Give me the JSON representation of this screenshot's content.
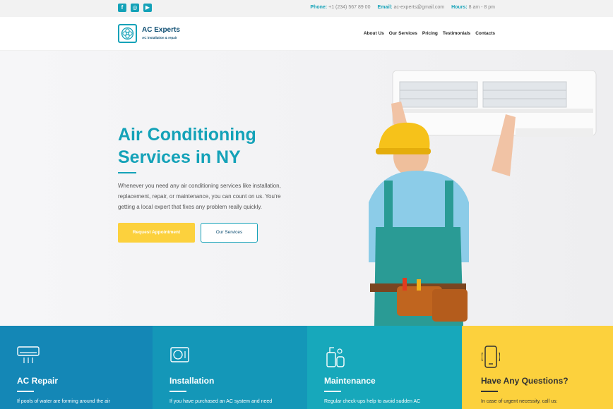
{
  "topbar": {
    "social": [
      {
        "icon": "facebook-icon",
        "glyph": "f"
      },
      {
        "icon": "instagram-icon",
        "glyph": "◎"
      },
      {
        "icon": "youtube-icon",
        "glyph": "▶"
      }
    ],
    "phone_label": "Phone:",
    "phone_value": "+1 (234) 567 89 00",
    "email_label": "Email:",
    "email_value": "ac-experts@gmail.com",
    "hours_label": "Hours:",
    "hours_value": "8 am - 8 pm"
  },
  "header": {
    "brand_name": "AC Experts",
    "brand_tagline": "AC installation & repair",
    "nav": [
      "About Us",
      "Our Services",
      "Pricing",
      "Testimonials",
      "Contacts"
    ]
  },
  "hero": {
    "title": "Air Conditioning Services in NY",
    "text": "Whenever you need any air conditioning services like installation, replacement, repair, or maintenance, you can count on us. You're getting a local expert that fixes any problem really quickly.",
    "primary_button": "Request Appointment",
    "secondary_button": "Our Services"
  },
  "services": [
    {
      "title": "AC Repair",
      "text": "If pools of water are forming around the air",
      "icon": "ac-unit-icon"
    },
    {
      "title": "Installation",
      "text": "If you have purchased an AC system and need",
      "icon": "installation-icon"
    },
    {
      "title": "Maintenance",
      "text": "Regular check-ups help to avoid sudden AC",
      "icon": "maintenance-icon"
    },
    {
      "title": "Have Any Questions?",
      "text": "In case of urgent necessity, call us:",
      "icon": "phone-icon"
    }
  ],
  "colors": {
    "accent": "#14a2b8",
    "brand_dark": "#0f4f73",
    "button_yellow": "#fcd13d",
    "panel_blue_1": "#1487b6",
    "panel_blue_2": "#1497b8",
    "panel_blue_3": "#17a8bb"
  }
}
